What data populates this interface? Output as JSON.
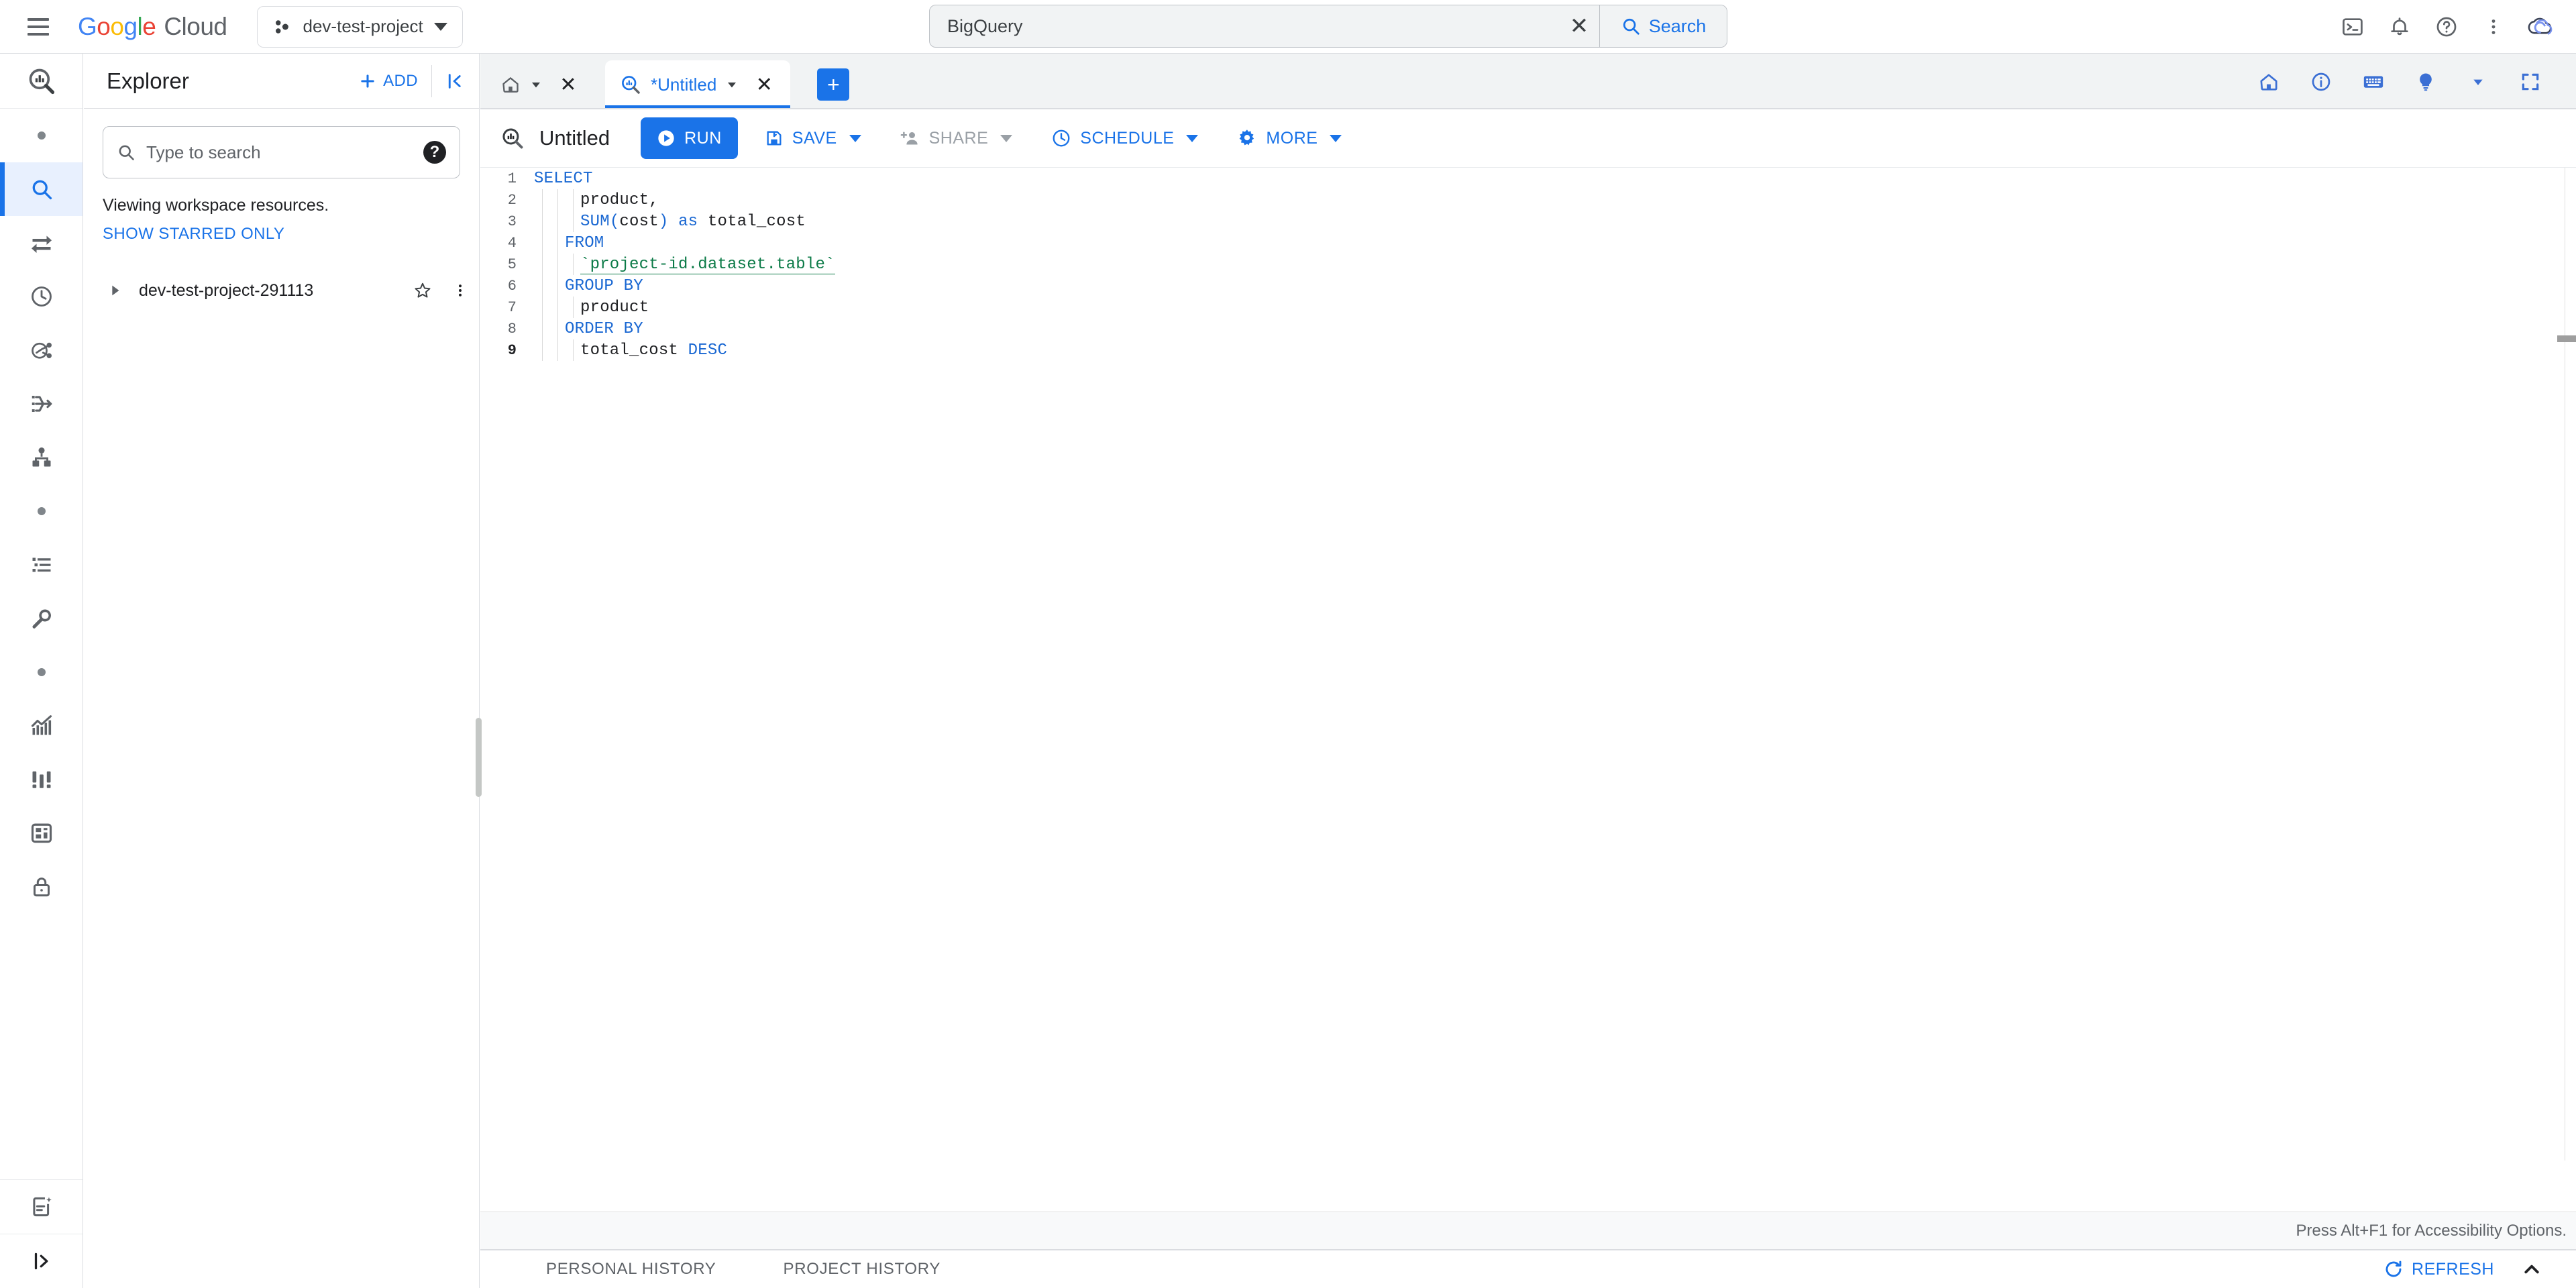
{
  "topbar": {
    "menu_icon": "hamburger-menu-icon",
    "brand": {
      "google": "Google",
      "cloud": "Cloud"
    },
    "project_selector": {
      "label": "dev-test-project",
      "icon": "project-icon"
    },
    "search": {
      "value": "BigQuery",
      "placeholder": "Search",
      "clear_label": "✕",
      "button_label": "Search"
    },
    "actions": [
      {
        "name": "cloud-shell-icon",
        "title": "Activate Cloud Shell"
      },
      {
        "name": "notifications-bell-icon",
        "title": "Notifications"
      },
      {
        "name": "help-circle-icon",
        "title": "Support"
      },
      {
        "name": "more-vert-icon",
        "title": "More options"
      },
      {
        "name": "account-avatar-icon",
        "title": "Account"
      }
    ]
  },
  "rail": {
    "header_icon": "bigquery-studio-icon",
    "items": [
      {
        "name": "rail-dot-1",
        "type": "dot"
      },
      {
        "name": "rail-item-explorer",
        "icon": "search-icon",
        "active": true
      },
      {
        "name": "rail-item-data-transfers",
        "icon": "transfer-arrows-icon",
        "active": false
      },
      {
        "name": "rail-item-scheduled-queries",
        "icon": "clock-icon",
        "active": false
      },
      {
        "name": "rail-item-analytics-hub",
        "icon": "analytics-hub-icon",
        "active": false
      },
      {
        "name": "rail-item-pipelines",
        "icon": "pipeline-icon",
        "active": false
      },
      {
        "name": "rail-item-dataform",
        "icon": "dataform-node-icon",
        "active": false
      },
      {
        "name": "rail-dot-2",
        "type": "dot"
      },
      {
        "name": "rail-item-jobs",
        "icon": "list-icon",
        "active": false
      },
      {
        "name": "rail-item-admin",
        "icon": "wrench-icon",
        "active": false
      },
      {
        "name": "rail-dot-3",
        "type": "dot"
      },
      {
        "name": "rail-item-monitoring",
        "icon": "chart-trending-icon",
        "active": false
      },
      {
        "name": "rail-item-capacity",
        "icon": "slot-bars-icon",
        "active": false
      },
      {
        "name": "rail-item-bi-engine",
        "icon": "dashboard-grid-icon",
        "active": false
      },
      {
        "name": "rail-item-policy-tags",
        "icon": "lock-icon",
        "active": false
      }
    ],
    "bottom": [
      {
        "name": "rail-item-release-notes",
        "icon": "document-sparkle-icon"
      },
      {
        "name": "rail-item-expand",
        "icon": "expand-rail-icon"
      }
    ]
  },
  "explorer": {
    "title": "Explorer",
    "add_label": "ADD",
    "add_icon": "plus-icon",
    "collapse_icon": "collapse-panel-icon",
    "search": {
      "placeholder": "Type to search",
      "value": "",
      "icon": "search-icon",
      "help_icon": "help-filled-icon"
    },
    "note": "Viewing workspace resources.",
    "starred_label": "SHOW STARRED ONLY",
    "tree": [
      {
        "name": "tree-item-project",
        "label": "dev-test-project-291113",
        "expand_icon": "chevron-right-icon",
        "star_icon": "star-outline-icon",
        "more_icon": "more-vert-icon"
      }
    ]
  },
  "tabs": {
    "home": {
      "name": "home-tab",
      "icon": "home-icon",
      "caret": "caret-down-icon",
      "close": "✕"
    },
    "query": {
      "name": "query-tab",
      "icon": "bigquery-query-icon",
      "label": "*Untitled",
      "caret": "caret-down-icon",
      "close": "✕"
    },
    "new_tab_label": "+",
    "right_icons": [
      {
        "name": "home-outline-icon"
      },
      {
        "name": "info-circle-icon"
      },
      {
        "name": "keyboard-icon"
      },
      {
        "name": "lightbulb-icon"
      },
      {
        "name": "lightbulb-caret-icon"
      },
      {
        "name": "fullscreen-icon"
      }
    ]
  },
  "query_toolbar": {
    "icon": "bigquery-query-icon",
    "title": "Untitled",
    "run_label": "RUN",
    "run_icon": "play-icon",
    "buttons": [
      {
        "name": "save-button",
        "label": "SAVE",
        "icon": "save-icon",
        "has_caret": true,
        "disabled": false
      },
      {
        "name": "share-button",
        "label": "SHARE",
        "icon": "person-add-icon",
        "has_caret": true,
        "disabled": true
      },
      {
        "name": "schedule-button",
        "label": "SCHEDULE",
        "icon": "clock-icon",
        "has_caret": true,
        "disabled": false
      },
      {
        "name": "more-button",
        "label": "MORE",
        "icon": "gear-icon",
        "has_caret": true,
        "disabled": false
      }
    ]
  },
  "editor": {
    "lines": [
      {
        "n": "1",
        "indent": 0,
        "tokens": [
          {
            "t": "SELECT",
            "c": "kw"
          }
        ]
      },
      {
        "n": "2",
        "indent": 3,
        "tokens": [
          {
            "t": "product,",
            "c": ""
          }
        ]
      },
      {
        "n": "3",
        "indent": 3,
        "tokens": [
          {
            "t": "SUM",
            "c": "kw"
          },
          {
            "t": "(",
            "c": "kw"
          },
          {
            "t": "cost",
            "c": ""
          },
          {
            "t": ")",
            "c": "kw"
          },
          {
            "t": " ",
            "c": ""
          },
          {
            "t": "as",
            "c": "kw"
          },
          {
            "t": " total_cost",
            "c": ""
          }
        ]
      },
      {
        "n": "4",
        "indent": 2,
        "tokens": [
          {
            "t": "FROM",
            "c": "kw"
          }
        ]
      },
      {
        "n": "5",
        "indent": 3,
        "tokens": [
          {
            "t": "`project-id.dataset.table`",
            "c": "str"
          }
        ]
      },
      {
        "n": "6",
        "indent": 2,
        "tokens": [
          {
            "t": "GROUP BY",
            "c": "kw"
          }
        ]
      },
      {
        "n": "7",
        "indent": 3,
        "tokens": [
          {
            "t": "product",
            "c": ""
          }
        ]
      },
      {
        "n": "8",
        "indent": 2,
        "tokens": [
          {
            "t": "ORDER BY",
            "c": "kw"
          }
        ]
      },
      {
        "n": "9",
        "indent": 3,
        "tokens": [
          {
            "t": "total_cost ",
            "c": ""
          },
          {
            "t": "DESC",
            "c": "kw"
          }
        ]
      }
    ],
    "accessibility_hint": "Press Alt+F1 for Accessibility Options."
  },
  "history": {
    "personal_label": "PERSONAL HISTORY",
    "project_label": "PROJECT HISTORY",
    "refresh_label": "REFRESH",
    "refresh_icon": "refresh-icon",
    "collapse_icon": "chevron-up-icon"
  },
  "colors": {
    "accent": "#1a73e8",
    "keyword": "#1967d2",
    "string": "#0b7a47",
    "surface": "#ffffff",
    "chrome": "#f1f3f4",
    "border": "#dadce0",
    "text": "#202124",
    "muted": "#5f6368",
    "disabled": "#9aa0a6"
  }
}
